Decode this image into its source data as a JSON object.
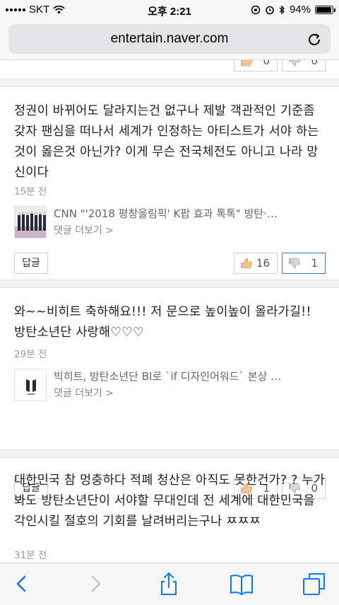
{
  "status_bar": {
    "carrier": "SKT",
    "time": "오후 2:21",
    "battery": "94%",
    "battery_level": 0.94
  },
  "browser": {
    "url": "entertain.naver.com"
  },
  "top_comment_partial": {
    "likes": "0",
    "dislikes": "0"
  },
  "comments": [
    {
      "text": "정권이 바뀌어도 달라지는건 없구나 제발 객관적인 기준좀 갖자 팬심을 떠나서 세계가 인정하는 아티스트가 서야 하는것이 옳은것 아닌가? 이게 무슨 전국체전도 아니고 나라 망신이다",
      "time": "15분 전",
      "article_title": "CNN \"'2018 평창올림픽' K팝 효과 톡톡\" 방탄·…",
      "article_more": "댓글 더보기 >",
      "reply_label": "답글",
      "likes": "16",
      "dislikes": "1"
    },
    {
      "text": "와~~비히트 축하해요!!! 저 문으로 높이높이 올라가길!! 방탄소년단 사랑해♡♡♡",
      "time": "29분 전",
      "article_title": "빅히트, 방탄소년단 BI로 `if 디자인어워드` 본상 …",
      "article_more": "댓글 더보기 >",
      "reply_label": "답글",
      "likes": "1",
      "dislikes": "0"
    },
    {
      "text": "대한민국 참 멍충하다 적폐 청산은 아직도 못한건가? ? 누가봐도 방탄소년단이 서야할 무대인데 전 세계에 대한민국을 각인시킬 절호의 기회를 날려버리는구나 ㅉㅉㅉ",
      "time": "31분 전"
    }
  ],
  "icons": [
    "wifi-icon",
    "reload-icon",
    "thumbs-up-icon",
    "thumbs-down-icon",
    "back-icon",
    "forward-icon",
    "share-icon",
    "bookmarks-icon",
    "tabs-icon"
  ],
  "colors": {
    "accent": "#3b7bd4",
    "safari_blue": "#0a7aff"
  }
}
